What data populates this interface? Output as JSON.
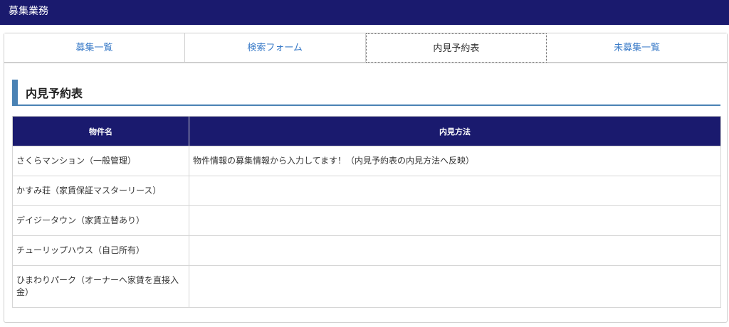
{
  "app": {
    "title": "募集業務"
  },
  "tabs": [
    {
      "label": "募集一覧"
    },
    {
      "label": "検索フォーム"
    },
    {
      "label": "内見予約表"
    },
    {
      "label": "未募集一覧"
    }
  ],
  "active_tab": "内見予約表",
  "section": {
    "title": "内見予約表"
  },
  "table": {
    "headers": {
      "property": "物件名",
      "method": "内見方法"
    },
    "rows": [
      {
        "property": "さくらマンション（一般管理）",
        "method": "物件情報の募集情報から入力してます！（内見予約表の内見方法へ反映）"
      },
      {
        "property": "かすみ荘（家賃保証マスターリース）",
        "method": ""
      },
      {
        "property": "デイジータウン（家賃立替あり）",
        "method": ""
      },
      {
        "property": "チューリップハウス（自己所有）",
        "method": ""
      },
      {
        "property": "ひまわりパーク（オーナーへ家賃を直接入金）",
        "method": ""
      }
    ]
  },
  "colors": {
    "header_bg": "#1a1a6e",
    "accent": "#4a82b4",
    "tab_link": "#3a7bc8"
  }
}
